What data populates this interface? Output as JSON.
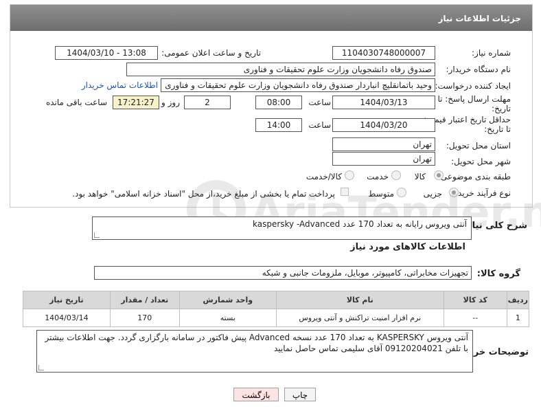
{
  "header": {
    "title": "جزئیات اطلاعات نیاز"
  },
  "fields": {
    "need_number": {
      "label": "شماره نیاز:",
      "value": "1104030748000007"
    },
    "announce_date": {
      "label": "تاریخ و ساعت اعلان عمومی:",
      "value": "1404/03/10 - 13:08"
    },
    "buyer_org": {
      "label": "نام دستگاه خریدار:",
      "value": "صندوق رفاه دانشجویان وزارت علوم  تحقیقات و فناوری"
    },
    "requester": {
      "label": "ایجاد کننده درخواست:",
      "value": "وحید باتمانقلیچ انباردار صندوق رفاه دانشجویان وزارت علوم  تحقیقات و فناوری",
      "link": "اطلاعات تماس خریدار"
    },
    "reply_deadline": {
      "label_line1": "مهلت ارسال پاسخ: تا",
      "label_line2": "تاریخ:",
      "date": "1404/03/13",
      "time_label": "ساعت",
      "time": "08:00",
      "days": "2",
      "days_label": "روز و",
      "remaining": "17:21:27",
      "remaining_label": "ساعت باقی مانده"
    },
    "price_validity": {
      "label_line1": "حداقل تاریخ اعتبار قیمت:",
      "label_line2": "تا تاریخ:",
      "date": "1404/03/20",
      "time_label": "ساعت",
      "time": "14:00"
    },
    "province": {
      "label": "استان محل تحویل:",
      "value": "تهران"
    },
    "city": {
      "label": "شهر محل تحویل:",
      "value": "تهران"
    },
    "category": {
      "label": "طبقه بندی موضوعی:",
      "options": [
        "کالا",
        "خدمت",
        "کالا/خدمت"
      ],
      "selected": "کالا"
    },
    "purchase_type": {
      "label": "نوع فرآیند خرید :",
      "options": [
        "جزیی",
        "متوسط"
      ],
      "selected": "جزیی",
      "note": "پرداخت تمام یا بخشی از مبلغ خرید،از محل \"اسناد خزانه اسلامی\" خواهد بود."
    }
  },
  "description": {
    "label": "شرح کلی نیاز:",
    "value": "آنتی ویروس رایانه به تعداد 170 عدد kaspersky -Advanced"
  },
  "goods_section": {
    "title": "اطلاعات کالاهای مورد نیاز"
  },
  "goods_group": {
    "label": "گروه کالا:",
    "value": "تجهیزات مخابراتی، کامپیوتر، موبایل، ملزومات جانبی و شبکه"
  },
  "table": {
    "headers": [
      "ردیف",
      "کد کالا",
      "نام کالا",
      "واحد شمارش",
      "تعداد / مقدار",
      "تاریخ نیاز"
    ],
    "rows": [
      [
        "1",
        "--",
        "نرم افزار امنیت تراکنش و آنتی ویروس",
        "بسته",
        "170",
        "1404/03/14"
      ]
    ]
  },
  "buyer_notes": {
    "label": "توضیحات خریدار:",
    "value": "آنتی ویروس KASPERSKY به تعداد 170 عدد نسخه Advanced  پیش فاکتور در سامانه بارگزاری گردد. جهت اطلاعات بیشتر با تلفن 09120204021 آقای سلیمی تماس حاصل نمایید"
  },
  "buttons": {
    "print": "چاپ",
    "back": "بازگشت"
  },
  "watermark": {
    "text": "AriaTender.neT"
  },
  "colors": {
    "header_bg": "#7d7d7d",
    "link": "#1a56b8",
    "back_button_bg": "#fde3e3"
  }
}
